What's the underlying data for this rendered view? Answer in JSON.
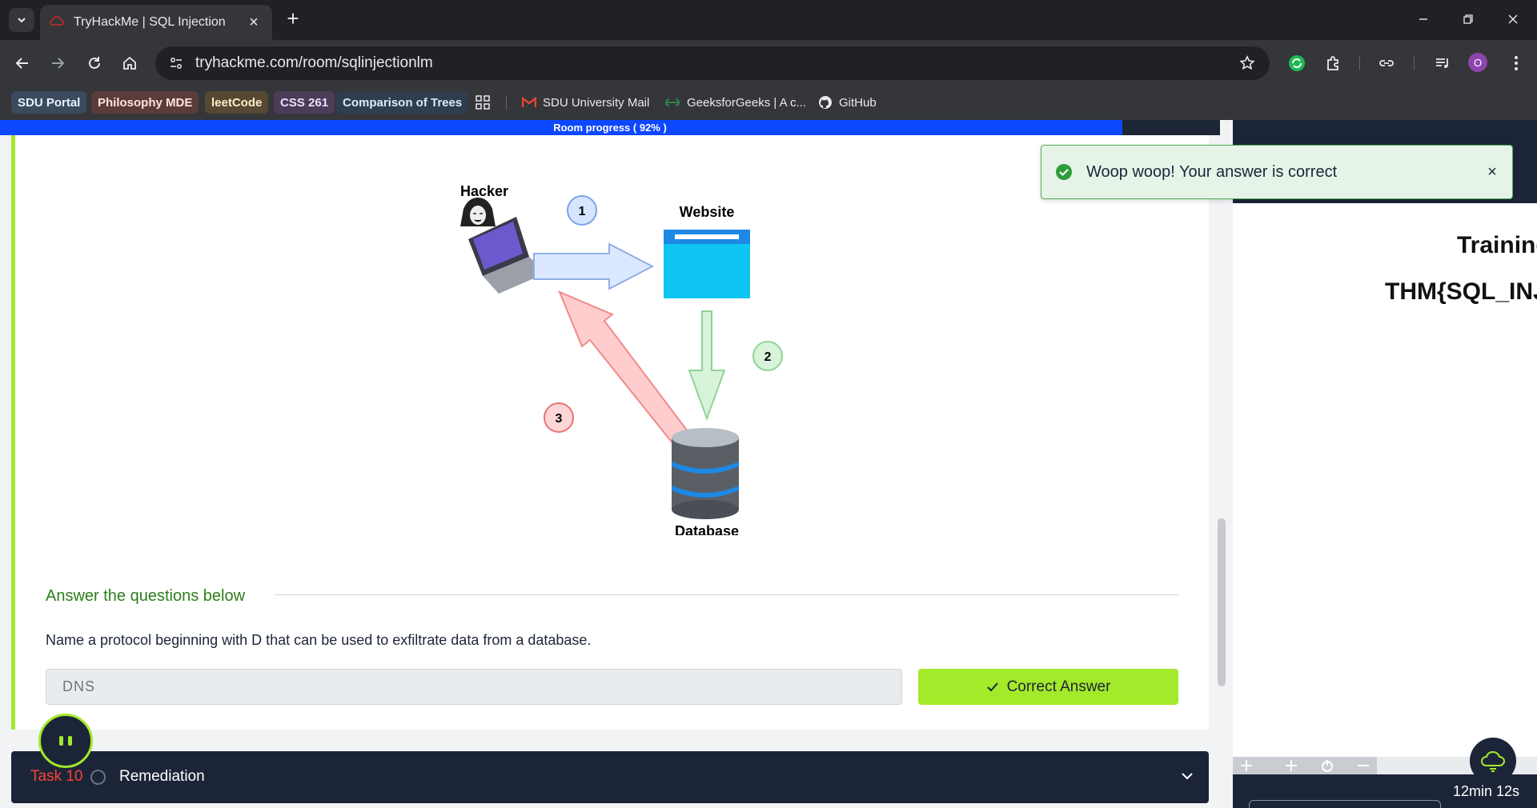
{
  "browser": {
    "tab_title": "TryHackMe | SQL Injection",
    "url": "tryhackme.com/room/sqlinjectionlm",
    "profile_initial": "O",
    "bookmarks": [
      {
        "label": "SDU Portal"
      },
      {
        "label": "Philosophy MDE"
      },
      {
        "label": "leetCode"
      },
      {
        "label": "CSS 261"
      },
      {
        "label": "Comparison of Trees"
      },
      {
        "label": "SDU University Mail"
      },
      {
        "label": "GeeksforGeeks | A c..."
      },
      {
        "label": "GitHub"
      }
    ]
  },
  "room": {
    "progress_label": "Room progress ( 92% )",
    "progress": 0.92
  },
  "diagram": {
    "hacker_label": "Hacker",
    "website_label": "Website",
    "database_label": "Database",
    "steps": [
      "1",
      "2",
      "3"
    ]
  },
  "questions": {
    "header": "Answer the questions below",
    "question_text": "Name a protocol beginning with D that can be used to exfiltrate data from a database.",
    "answer_value": "DNS",
    "submit_label": "Correct Answer"
  },
  "task": {
    "number_label": "Task 10",
    "title": "Remediation"
  },
  "toast": {
    "message": "Woop woop! Your answer is correct",
    "close": "×"
  },
  "right_pane": {
    "training_text": "Training",
    "flag_text": "THM{SQL_INJ",
    "timer": "12min 12s"
  },
  "colors": {
    "accent": "#a3ea2a",
    "navy": "#1c2538",
    "progress_blue": "#0d47ff",
    "task_red": "#f44336"
  }
}
